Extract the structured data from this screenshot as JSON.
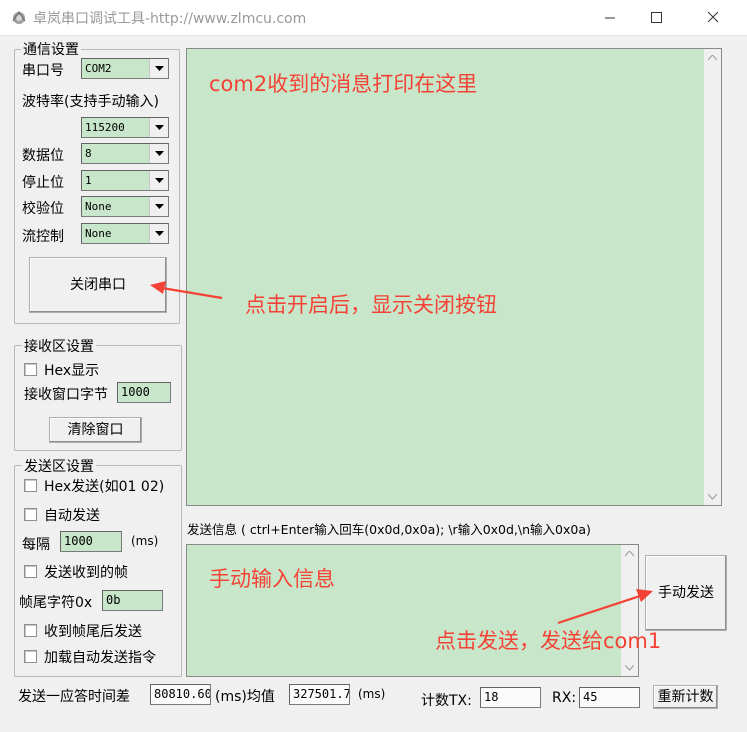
{
  "window": {
    "title": "卓岚串口调试工具-http://www.zlmcu.com"
  },
  "comm_settings": {
    "group_label": "通信设置",
    "port_label": "串口号",
    "port_value": "COM2",
    "baud_label": "波特率(支持手动输入)",
    "baud_value": "115200",
    "databits_label": "数据位",
    "databits_value": "8",
    "stopbits_label": "停止位",
    "stopbits_value": "1",
    "parity_label": "校验位",
    "parity_value": "None",
    "flow_label": "流控制",
    "flow_value": "None",
    "open_close_button": "关闭串口"
  },
  "recv_settings": {
    "group_label": "接收区设置",
    "hex_display_label": "Hex显示",
    "window_bytes_label": "接收窗口字节",
    "window_bytes_value": "1000",
    "clear_button": "清除窗口"
  },
  "send_settings": {
    "group_label": "发送区设置",
    "hex_send_label": "Hex发送(如01 02)",
    "auto_send_label": "自动发送",
    "interval_label": "每隔",
    "interval_value": "1000",
    "interval_unit": "(ms)",
    "send_recv_frame_label": "发送收到的帧",
    "frame_tail_label": "帧尾字符0x",
    "frame_tail_value": "0b",
    "send_after_tail_label": "收到帧尾后发送",
    "load_auto_cmd_label": "加载自动发送指令"
  },
  "receive_area": {
    "annotation": "com2收到的消息打印在这里"
  },
  "send_info_hint": "发送信息 ( ctrl+Enter输入回车(0x0d,0x0a); \\r输入0x0d,\\n输入0x0a)",
  "send_area": {
    "annotation": "手动输入信息"
  },
  "manual_send_button": "手动发送",
  "annotations": {
    "close_button_note": "点击开启后，显示关闭按钮",
    "send_note": "点击发送，发送给com1"
  },
  "status_bar": {
    "response_time_label": "发送一应答时间差",
    "response_time_value": "80810.60",
    "ms_avg_label": "(ms)均值",
    "avg_value": "327501.7",
    "ms_label": "(ms)",
    "count_tx_label": "计数TX:",
    "tx_value": "18",
    "rx_label": "RX:",
    "rx_value": "45",
    "recount_button": "重新计数"
  },
  "colors": {
    "field_green": "#c8e6c9",
    "annotation_red": "#f44336"
  }
}
